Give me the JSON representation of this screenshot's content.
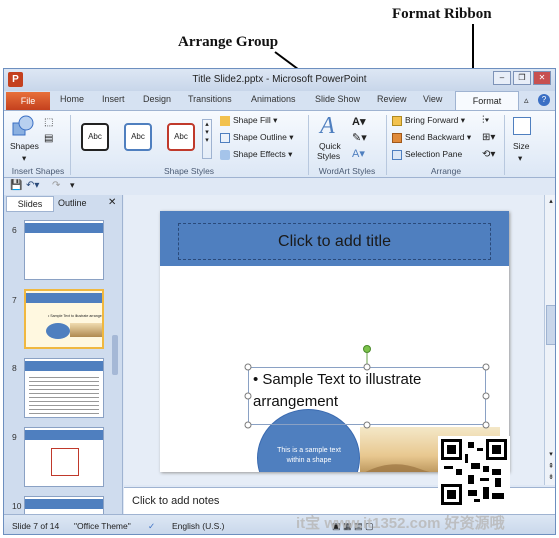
{
  "annotations": {
    "format_ribbon": "Format Ribbon",
    "arrange_group": "Arrange Group"
  },
  "window": {
    "title": "Title Slide2.pptx - Microsoft PowerPoint"
  },
  "tabs": {
    "file": "File",
    "home": "Home",
    "insert": "Insert",
    "design": "Design",
    "transitions": "Transitions",
    "animations": "Animations",
    "slide_show": "Slide Show",
    "review": "Review",
    "view": "View",
    "format": "Format"
  },
  "ribbon": {
    "insert_shapes": {
      "shapes_label": "Shapes",
      "group_label": "Insert Shapes"
    },
    "shape_styles": {
      "style_sample": "Abc",
      "shape_fill": "Shape Fill",
      "shape_outline": "Shape Outline",
      "shape_effects": "Shape Effects",
      "group_label": "Shape Styles"
    },
    "wordart": {
      "quick_styles_line1": "Quick",
      "quick_styles_line2": "Styles",
      "group_label": "WordArt Styles"
    },
    "arrange": {
      "bring_forward": "Bring Forward",
      "send_backward": "Send Backward",
      "selection_pane": "Selection Pane",
      "group_label": "Arrange"
    },
    "size": {
      "size_label": "Size"
    }
  },
  "left_pane": {
    "tab_slides": "Slides",
    "tab_outline": "Outline",
    "thumbnails": [
      {
        "num": "6"
      },
      {
        "num": "7"
      },
      {
        "num": "8"
      },
      {
        "num": "9"
      },
      {
        "num": "10"
      }
    ],
    "thumb7_text": "• Sample Text to illustrate arrangement"
  },
  "slide": {
    "title_placeholder": "Click to add title",
    "bullet_text": "Sample Text to illustrate arrangement",
    "circle_text": "This is a sample text within a shape"
  },
  "notes": {
    "placeholder": "Click to add notes"
  },
  "status": {
    "slide_info": "Slide 7 of 14",
    "theme": "\"Office Theme\"",
    "language": "English (U.S.)"
  },
  "watermark": {
    "text": "it宝 www.it1352.com 好资源哦"
  },
  "colors": {
    "accent_blue": "#4f7fbf",
    "file_tab": "#c4401e",
    "circle": "#4f7fbf"
  }
}
